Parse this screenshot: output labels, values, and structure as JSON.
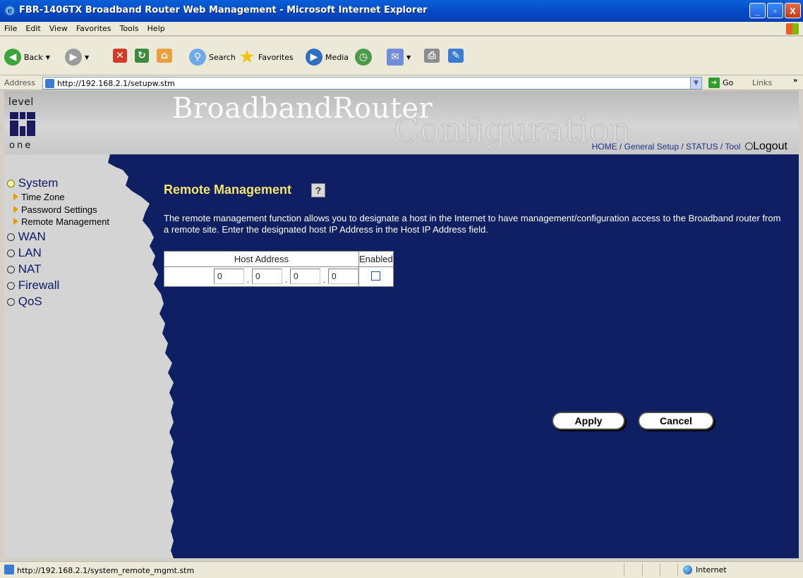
{
  "window": {
    "title": "FBR-1406TX Broadband Router Web Management - Microsoft Internet Explorer",
    "controls": [
      "_",
      "▫",
      "X"
    ]
  },
  "menu": [
    "File",
    "Edit",
    "View",
    "Favorites",
    "Tools",
    "Help"
  ],
  "toolbar": {
    "back": "Back",
    "search": "Search",
    "favorites": "Favorites",
    "media": "Media"
  },
  "address": {
    "label": "Address",
    "url": "http://192.168.2.1/setupw.stm",
    "go": "Go",
    "links": "Links"
  },
  "header": {
    "logo_top": "level",
    "logo_bottom": "one",
    "brand_line1": "BroadbandRouter",
    "brand_line2": "Configuration",
    "nav": {
      "home": "HOME",
      "general": "General Setup",
      "status": "STATUS",
      "tool": "Tool",
      "logout": "Logout"
    }
  },
  "sidebar": {
    "items": [
      {
        "label": "System"
      },
      {
        "label": "Time Zone"
      },
      {
        "label": "Password Settings"
      },
      {
        "label": "Remote Management"
      },
      {
        "label": "WAN"
      },
      {
        "label": "LAN"
      },
      {
        "label": "NAT"
      },
      {
        "label": "Firewall"
      },
      {
        "label": "QoS"
      }
    ]
  },
  "main": {
    "title": "Remote Management",
    "description": "The remote management function allows you to designate a host in the Internet to have management/configuration access to the Broadband router from a remote site. Enter the designated host IP Address in the Host IP Address field.",
    "table": {
      "col_host": "Host Address",
      "col_enabled": "Enabled",
      "ip": [
        "0",
        "0",
        "0",
        "0"
      ],
      "enabled": false
    },
    "apply": "Apply",
    "cancel": "Cancel"
  },
  "status": {
    "url": "http://192.168.2.1/system_remote_mgmt.stm",
    "zone": "Internet"
  }
}
